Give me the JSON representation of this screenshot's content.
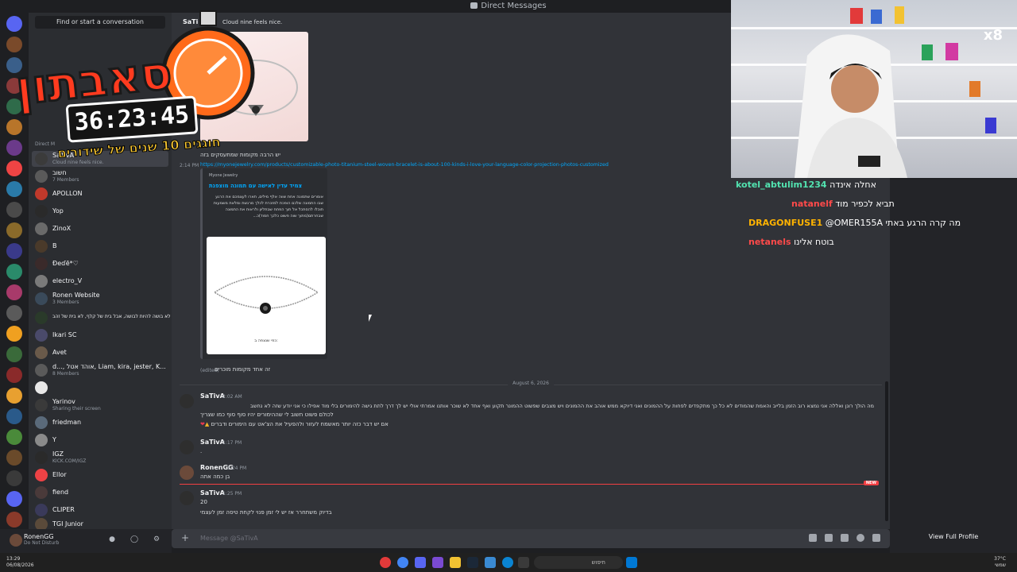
{
  "window": {
    "title": "Direct Messages"
  },
  "sidebar": {
    "find_placeholder": "Find or start a conversation",
    "dm_header": "Direct M",
    "dms": [
      {
        "name": "SaTivA",
        "sub": "Cloud nine feels nice.",
        "active": true
      },
      {
        "name": "חשוב",
        "sub": "7 Members"
      },
      {
        "name": "APOLLON",
        "sub": ""
      },
      {
        "name": "Yop",
        "sub": ""
      },
      {
        "name": "ZinoX",
        "sub": ""
      },
      {
        "name": "B",
        "sub": ""
      },
      {
        "name": "Ɖeɗē*♡",
        "sub": ""
      },
      {
        "name": "electro_V",
        "sub": ""
      },
      {
        "name": "Ronen Website",
        "sub": "3 Members"
      },
      {
        "name": "לא בושה להיות לבושה, אבל בית של קלף, לא בית של זהב",
        "sub": ""
      },
      {
        "name": "Ikari SC",
        "sub": ""
      },
      {
        "name": "Avet",
        "sub": ""
      },
      {
        "name": "d..., אוהד אטל, Liam, kira, jester, K...",
        "sub": "8 Members"
      },
      {
        "name": "",
        "sub": ""
      },
      {
        "name": "Yarinov",
        "sub": "Sharing their screen"
      },
      {
        "name": "friedman",
        "sub": ""
      },
      {
        "name": "Y",
        "sub": ""
      },
      {
        "name": "IGZ",
        "sub": "KICK.COM/IGZ"
      },
      {
        "name": "Ellor",
        "sub": ""
      },
      {
        "name": "fiend",
        "sub": ""
      },
      {
        "name": "CLIPER",
        "sub": ""
      },
      {
        "name": "TGI Junior",
        "sub": ""
      }
    ]
  },
  "user_panel": {
    "name": "RonenGG",
    "status": "Do Not Disturb"
  },
  "chat": {
    "header_author": "SaTi",
    "header_status": "Cloud nine feels nice.",
    "image_caption": "יש הרבה מקומות שמתעסקים בזה",
    "link_time": "2:14 PM",
    "link_url": "https://myonejewelry.com/products/customizable-photo-titanium-steel-woven-bracelet-is-about-100-kinds-i-love-your-language-color-projection-photos-customized",
    "embed": {
      "provider": "Myone Jewelry",
      "title": "צמיד עדין לאישה עם תמונה מוצפנת",
      "description": "אומרים שתמונה אחת שווה אלף מילים, תארו לעצמכם את הרגע שבו התמונה שלכם הופכת למזכרת לכלך מרגשת ומלאת משמעות תוכלו להסתכל אל תוך הפתח שבתליון ולראות את התמונה שבחרתם(מתוך שוה פשוט כלכך חמוד)כ...",
      "image_caption": "כפי שנצפה ב:"
    },
    "edited_label": "(edited)",
    "edited_text": "זה אחד מקומות מוכרים",
    "date_divider": "August 6, 2026",
    "messages": [
      {
        "author": "SaTivA",
        "time": "2:02 AM",
        "lines": [
          "מה הולך רונן ואללה אני נמצא רוב הזמן בלייב והאמת שהמודים לא כל כך מתקפדים לפחות על ההמונים ואני דיוקא ממש אוהב את ההמונים ויש מצבים שפשוט ההמונר תקוע ואף אחד לא שוכר אותנו אמרתי אולי יש לך דרך לתת גישה להימורים בלי מוד אפילו כי אני יודע שזה לא נחשב",
          "לכולם פשוט חשוב לי שההימורים יהיו סוף סוף כמו שצריך",
          "אם יש דבר כזה יותר מאשמח לעזור ולהפעיל את הצ'אט עם הימורים ודברים"
        ]
      },
      {
        "author": "SaTivA",
        "time": "1:17 PM",
        "lines": [
          "."
        ]
      },
      {
        "author": "RonenGG",
        "time": "1:24 PM",
        "lines": [
          "בן כמה אתה"
        ]
      },
      {
        "author": "SaTivA",
        "time": "1:25 PM",
        "lines": [
          "20",
          "בדיוק משתחרר אז יש לי זמן פנוי לקחת טיסה זמן לעצמי"
        ]
      }
    ],
    "new_label": "NEW",
    "composer_placeholder": "Message @SaTivA"
  },
  "right_panel": {
    "view_full_profile": "View Full Profile"
  },
  "stream_overlay": {
    "title": "סאבתון",
    "timer": "36:23:45",
    "subtitle": "חוגגים 10 שנים של שידורים",
    "multiplier": "x8"
  },
  "twitch_chat": [
    {
      "user": "kotel_abtulim1234",
      "text": "אחלה אינדה",
      "color": "#52e3b0"
    },
    {
      "user": "natanelf",
      "text": "תביא לכפיר מוד",
      "color": "#ff4a4a"
    },
    {
      "user": "DRAGONFUSE1",
      "text": "@OMER155A מה קרה הרגע באתי",
      "color": "#ffb300"
    },
    {
      "user": "netanels",
      "text": "בוטח אלינו",
      "color": "#ff4a4a"
    }
  ],
  "taskbar": {
    "time": "13:29",
    "date": "06/08/2026",
    "search_label": "חיפוש",
    "weather": "37°C",
    "weather_sub": "שמשי"
  }
}
